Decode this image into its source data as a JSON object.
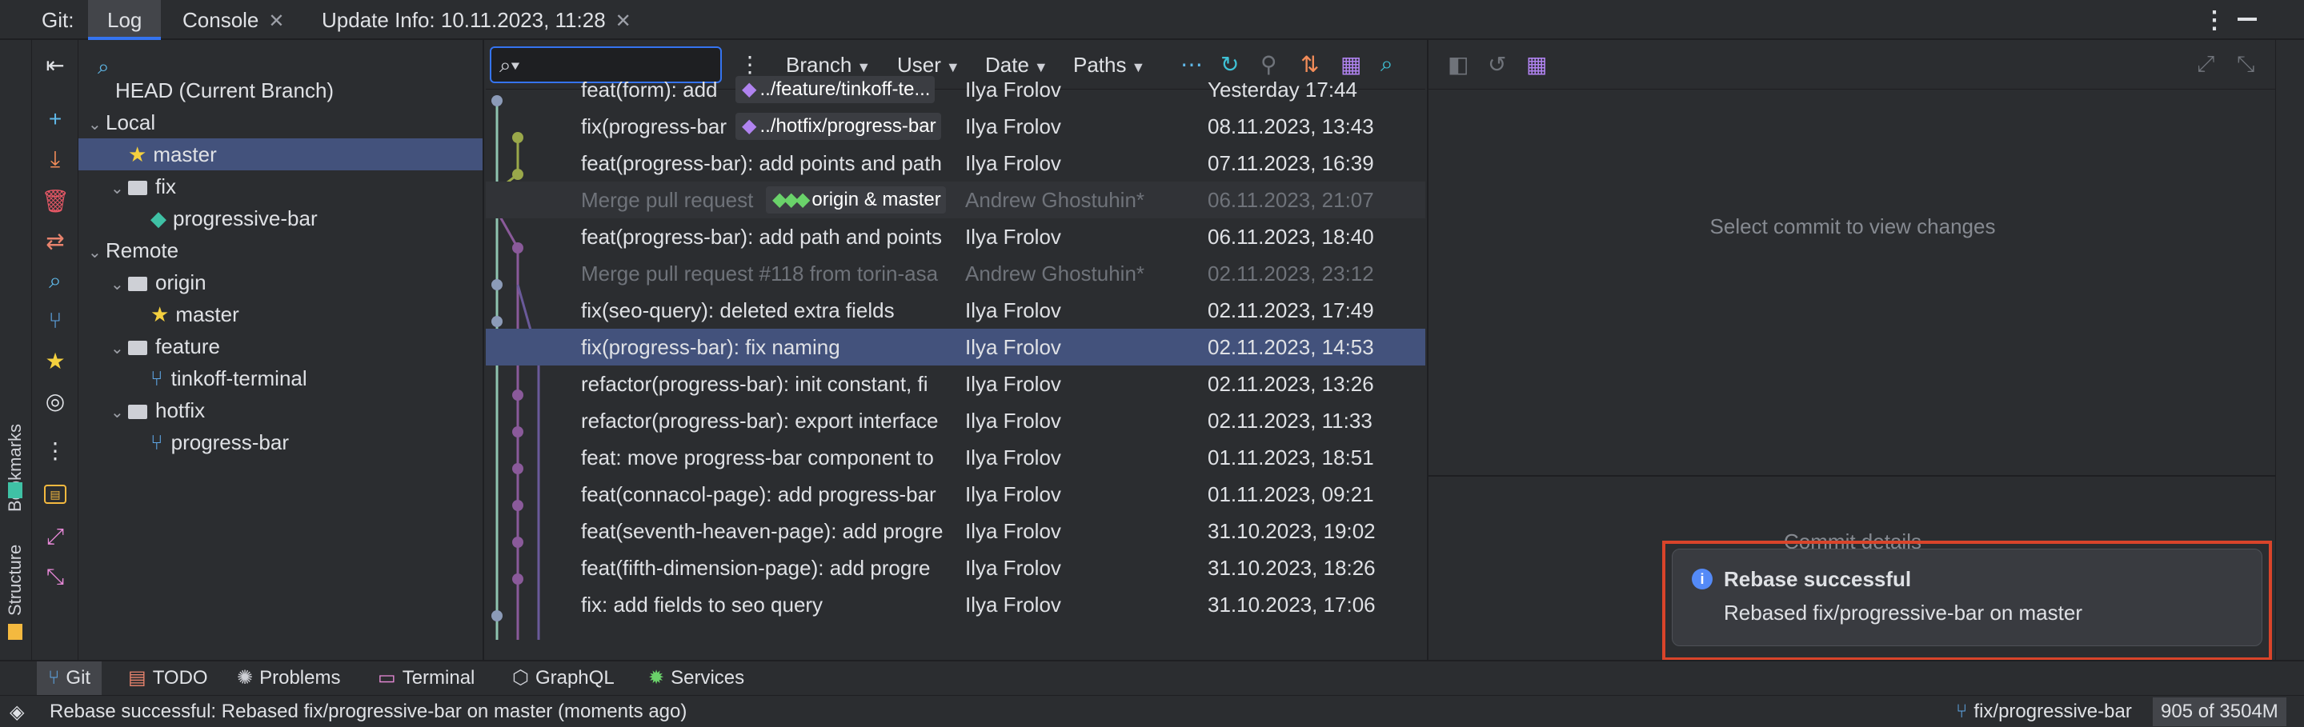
{
  "top": {
    "git_label": "Git:",
    "tabs": [
      {
        "label": "Log",
        "active": true
      },
      {
        "label": "Console",
        "closable": true
      },
      {
        "label": "Update Info: 10.11.2023, 11:28",
        "closable": true
      }
    ]
  },
  "side_labels": {
    "bookmarks": "Bookmarks",
    "structure": "Structure"
  },
  "tree": {
    "rows": [
      {
        "label": "HEAD (Current Branch)",
        "kind": "head",
        "indent": 0
      },
      {
        "label": "Local",
        "kind": "group",
        "indent": 0
      },
      {
        "label": "master",
        "kind": "star",
        "indent": 1,
        "selected": true
      },
      {
        "label": "fix",
        "kind": "folder",
        "indent": 1
      },
      {
        "label": "progressive-bar",
        "kind": "tag",
        "indent": 2
      },
      {
        "label": "Remote",
        "kind": "group",
        "indent": 0
      },
      {
        "label": "origin",
        "kind": "folder",
        "indent": 1
      },
      {
        "label": "master",
        "kind": "star",
        "indent": 2
      },
      {
        "label": "feature",
        "kind": "folder",
        "indent": 1
      },
      {
        "label": "tinkoff-terminal",
        "kind": "branch",
        "indent": 2
      },
      {
        "label": "hotfix",
        "kind": "folder",
        "indent": 1
      },
      {
        "label": "progress-bar",
        "kind": "branch",
        "indent": 2
      }
    ]
  },
  "log": {
    "filters": {
      "branch": "Branch",
      "user": "User",
      "date": "Date",
      "paths": "Paths"
    },
    "commits": [
      {
        "msg": "feat(form): add",
        "ref": "../feature/tinkoff-te...",
        "author": "Ilya Frolov",
        "date": "Yesterday 17:44"
      },
      {
        "msg": "fix(progress-bar",
        "ref": "../hotfix/progress-bar",
        "author": "Ilya Frolov",
        "date": "08.11.2023, 13:43"
      },
      {
        "msg": "feat(progress-bar): add points and path",
        "author": "Ilya Frolov",
        "date": "07.11.2023, 16:39"
      },
      {
        "msg": "Merge pull request",
        "ref": "origin & master",
        "author": "Andrew Ghostuhin*",
        "date": "06.11.2023, 21:07",
        "merge": true
      },
      {
        "msg": "feat(progress-bar): add path and points",
        "author": "Ilya Frolov",
        "date": "06.11.2023, 18:40"
      },
      {
        "msg": "Merge pull request #118 from torin-asa",
        "author": "Andrew Ghostuhin*",
        "date": "02.11.2023, 23:12",
        "merge": true
      },
      {
        "msg": "fix(seo-query): deleted extra fields",
        "author": "Ilya Frolov",
        "date": "02.11.2023, 17:49"
      },
      {
        "msg": "fix(progress-bar): fix naming",
        "author": "Ilya Frolov",
        "date": "02.11.2023, 14:53",
        "selected": true
      },
      {
        "msg": "refactor(progress-bar): init constant, fi",
        "author": "Ilya Frolov",
        "date": "02.11.2023, 13:26"
      },
      {
        "msg": "refactor(progress-bar): export interface",
        "author": "Ilya Frolov",
        "date": "02.11.2023, 11:33"
      },
      {
        "msg": "feat: move progress-bar component to",
        "author": "Ilya Frolov",
        "date": "01.11.2023, 18:51"
      },
      {
        "msg": "feat(connacol-page): add progress-bar",
        "author": "Ilya Frolov",
        "date": "01.11.2023, 09:21"
      },
      {
        "msg": "feat(seventh-heaven-page): add progre",
        "author": "Ilya Frolov",
        "date": "31.10.2023, 19:02"
      },
      {
        "msg": "feat(fifth-dimension-page): add progre",
        "author": "Ilya Frolov",
        "date": "31.10.2023, 18:26"
      },
      {
        "msg": "fix: add fields to seo query",
        "author": "Ilya Frolov",
        "date": "31.10.2023, 17:06"
      }
    ]
  },
  "details": {
    "empty": "Select commit to view changes",
    "commit_details": "Commit details"
  },
  "notification": {
    "title": "Rebase successful",
    "body": "Rebased fix/progressive-bar on master"
  },
  "bottom_tabs": [
    {
      "label": "Git",
      "icon": "git-branch-icon",
      "active": true
    },
    {
      "label": "TODO",
      "icon": "todo-icon"
    },
    {
      "label": "Problems",
      "icon": "bug-icon"
    },
    {
      "label": "Terminal",
      "icon": "terminal-icon"
    },
    {
      "label": "GraphQL",
      "icon": "graphql-icon"
    },
    {
      "label": "Services",
      "icon": "services-icon"
    }
  ],
  "status": {
    "message": "Rebase successful: Rebased fix/progressive-bar on master (moments ago)",
    "branch": "fix/progressive-bar",
    "memory": "905 of 3504M"
  },
  "colors": {
    "accent": "#3574f0",
    "selection": "#43527c",
    "notification_outline": "#d9442a"
  }
}
